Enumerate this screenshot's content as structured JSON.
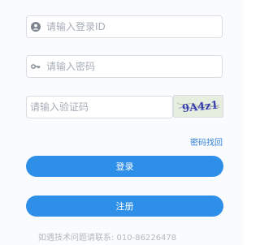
{
  "login": {
    "username_placeholder": "请输入登录ID",
    "password_placeholder": "请输入密码",
    "captcha_placeholder": "请输入验证码",
    "captcha_code": "9A4z1",
    "forgot_label": "密码找回",
    "login_label": "登录",
    "register_label": "注册"
  },
  "footer": {
    "support_text": "如遇技术问题请联系: 010-86226478"
  },
  "colors": {
    "accent": "#2e8fe8",
    "link": "#2f7fd8"
  },
  "icons": {
    "username": "user-icon",
    "password": "key-icon"
  }
}
